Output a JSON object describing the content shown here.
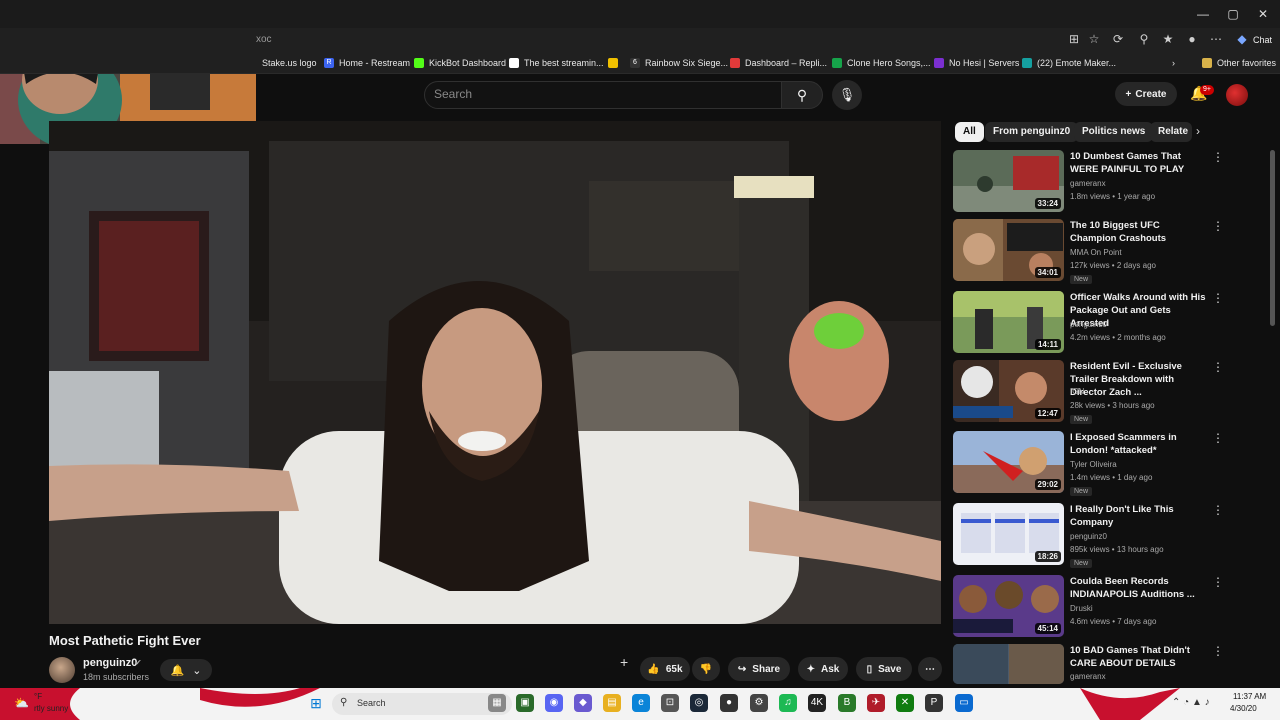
{
  "browser": {
    "address_text": "xoc",
    "chat_label": "Chat",
    "bookmarks": [
      {
        "label": "Stake.us logo",
        "color": "#2a2a2a"
      },
      {
        "label": "Home - Restream",
        "color": "#3c64f0"
      },
      {
        "label": "KickBot Dashboard",
        "color": "#53fc18"
      },
      {
        "label": "The best streamin...",
        "color": "#ffffff"
      },
      {
        "label": "",
        "color": "#f0c000"
      },
      {
        "label": "Rainbow Six Siege...",
        "color": "#333333"
      },
      {
        "label": "Dashboard – Repli...",
        "color": "#e03a3a"
      },
      {
        "label": "Clone Hero Songs,...",
        "color": "#16a34a"
      },
      {
        "label": "No Hesi | Servers",
        "color": "#7b2fd0"
      },
      {
        "label": "(22) Emote Maker...",
        "color": "#15a0a0"
      }
    ],
    "other_favorites": "Other favorites"
  },
  "youtube": {
    "search_placeholder": "Search",
    "create_label": "Create",
    "notification_count": "9+",
    "video": {
      "title": "Most Pathetic Fight Ever",
      "channel": "penguinz0",
      "subscribers": "18m subscribers",
      "likes": "65k",
      "share": "Share",
      "ask": "Ask",
      "save": "Save"
    },
    "chips": [
      "All",
      "From penguinz0",
      "Politics news",
      "Relate"
    ],
    "recommendations": [
      {
        "title": "10 Dumbest Games That WERE PAINFUL TO PLAY",
        "channel": "gameranx",
        "meta": "1.8m views • 1 year ago",
        "duration": "33:24",
        "new": "",
        "thumb": "#5b6b58"
      },
      {
        "title": "The 10 Biggest UFC Champion Crashouts",
        "channel": "MMA On Point",
        "meta": "127k views • 2 days ago",
        "duration": "34:01",
        "new": "New",
        "thumb": "#7a5a3a"
      },
      {
        "title": "Officer Walks Around with His Package Out and Gets Arrested",
        "channel": "penguinz0",
        "meta": "4.2m views • 2 months ago",
        "duration": "14:11",
        "new": "",
        "thumb": "#6c8b4a"
      },
      {
        "title": "Resident Evil - Exclusive Trailer Breakdown with Director Zach ...",
        "channel": "IGN",
        "meta": "28k views • 3 hours ago",
        "duration": "12:47",
        "new": "New",
        "thumb": "#3a2a22"
      },
      {
        "title": "I Exposed Scammers in London! *attacked*",
        "channel": "Tyler Oliveira",
        "meta": "1.4m views • 1 day ago",
        "duration": "29:02",
        "new": "New",
        "thumb": "#8a6a5a"
      },
      {
        "title": "I Really Don't Like This Company",
        "channel": "penguinz0",
        "meta": "895k views • 13 hours ago",
        "duration": "18:26",
        "new": "New",
        "thumb": "#e8ebf2"
      },
      {
        "title": "Coulda Been Records INDIANAPOLIS Auditions ...",
        "channel": "Druski",
        "meta": "4.6m views • 7 days ago",
        "duration": "45:14",
        "new": "",
        "thumb": "#4a3a6a"
      },
      {
        "title": "10 BAD Games That Didn't CARE ABOUT DETAILS",
        "channel": "gameranx",
        "meta": "",
        "duration": "",
        "new": "",
        "thumb": "#4c5a6a"
      }
    ]
  },
  "taskbar": {
    "temp": "°F",
    "weather": "rtly sunny",
    "search_label": "Search",
    "time": "11:37 AM",
    "date": "4/30/20"
  }
}
